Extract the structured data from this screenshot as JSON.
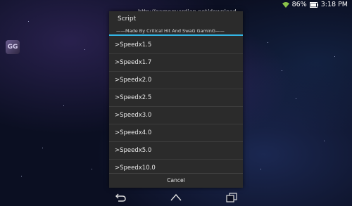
{
  "status": {
    "battery_percent": "86%",
    "time": "3:18 PM"
  },
  "overlay_url": "http://gameguardian.net/download",
  "desktop_app_icon": {
    "label": "GG"
  },
  "dialog": {
    "title": "Script",
    "subtitle": "——Made By Critical Hit And SwaG GaminG——",
    "accent_color": "#33b5e5",
    "items": [
      ">Speedx1.5",
      ">Speedx1.7",
      ">Speedx2.0",
      ">Speedx2.5",
      ">Speedx3.0",
      ">Speedx4.0",
      ">Speedx5.0",
      ">Speedx10.0"
    ],
    "cancel_label": "Cancel"
  },
  "navbar": {
    "buttons": [
      "back-icon",
      "home-icon",
      "recents-icon"
    ]
  }
}
